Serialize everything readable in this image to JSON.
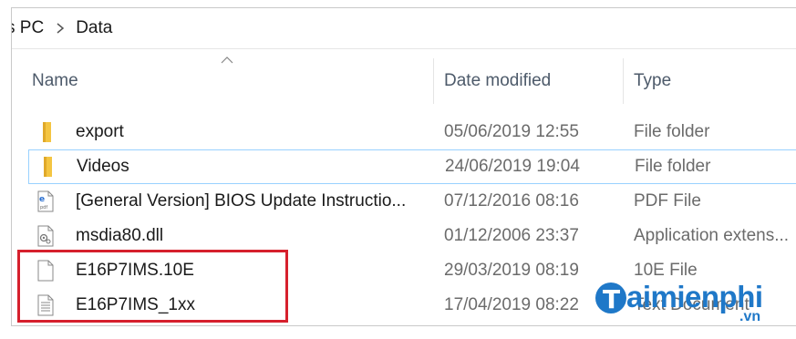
{
  "breadcrumb": {
    "items": [
      "s PC",
      "Data"
    ]
  },
  "columns": {
    "name": "Name",
    "date": "Date modified",
    "type": "Type"
  },
  "files": [
    {
      "name": "export",
      "date": "05/06/2019 12:55",
      "type": "File folder",
      "icon": "folder-icon"
    },
    {
      "name": "Videos",
      "date": "24/06/2019 19:04",
      "type": "File folder",
      "icon": "folder-icon"
    },
    {
      "name": "[General Version] BIOS Update Instructio...",
      "date": "07/12/2016 08:16",
      "type": "PDF File",
      "icon": "pdf-file-icon"
    },
    {
      "name": "msdia80.dll",
      "date": "01/12/2006 23:37",
      "type": "Application extens...",
      "icon": "dll-file-icon"
    },
    {
      "name": "E16P7IMS.10E",
      "date": "29/03/2019 08:19",
      "type": "10E File",
      "icon": "blank-file-icon"
    },
    {
      "name": "E16P7IMS_1xx",
      "date": "17/04/2019 08:22",
      "type": "Text Document",
      "icon": "text-file-icon"
    }
  ],
  "watermark": {
    "text": "aimienphi",
    "suffix": ".vn",
    "color": "#1f78c8"
  },
  "colors": {
    "highlight": "#d6202d",
    "folder": "#f4c542",
    "header_text": "#4d5a6a"
  }
}
